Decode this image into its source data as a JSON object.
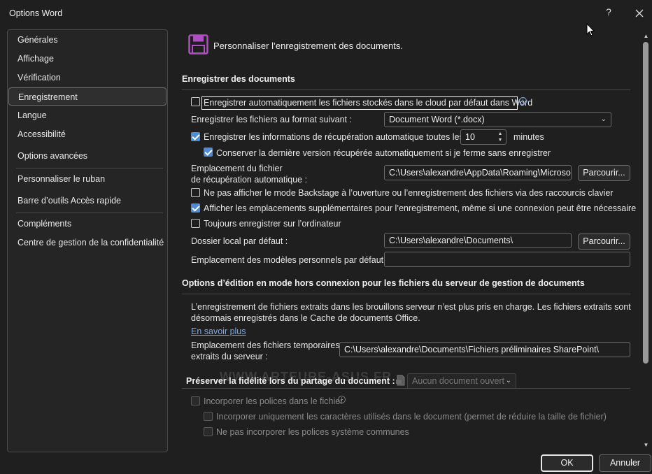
{
  "window": {
    "title": "Options Word",
    "help_label": "?"
  },
  "sidebar": {
    "items": [
      {
        "label": "Générales"
      },
      {
        "label": "Affichage"
      },
      {
        "label": "Vérification"
      },
      {
        "label": "Enregistrement"
      },
      {
        "label": "Langue"
      },
      {
        "label": "Accessibilité"
      },
      {
        "label": "Options avancées"
      },
      {
        "label": "Personnaliser le ruban"
      },
      {
        "label": "Barre d’outils Accès rapide"
      },
      {
        "label": "Compléments"
      },
      {
        "label": "Centre de gestion de la confidentialité"
      }
    ],
    "active_index": 3
  },
  "header": {
    "title": "Personnaliser l’enregistrement des documents."
  },
  "save_section": {
    "title": "Enregistrer des documents",
    "autosave_cloud": {
      "label": "Enregistrer automatiquement les fichiers stockés dans le cloud par défaut dans Word",
      "checked": false
    },
    "format": {
      "label": "Enregistrer les fichiers au format suivant :",
      "value": "Document Word (*.docx)"
    },
    "autorecover": {
      "label": "Enregistrer les informations de récupération automatique toutes les",
      "checked": true,
      "minutes": "10",
      "unit": "minutes"
    },
    "keep_last": {
      "label": "Conserver la dernière version récupérée automatiquement si je ferme sans enregistrer",
      "checked": true
    },
    "autorecover_location": {
      "label_line1": "Emplacement du fichier",
      "label_line2": "de récupération automatique :",
      "value": "C:\\Users\\alexandre\\AppData\\Roaming\\Microsof",
      "browse": "Parcourir..."
    },
    "no_backstage": {
      "label": "Ne pas afficher le mode Backstage à l’ouverture ou l’enregistrement des fichiers via des raccourcis clavier",
      "checked": false
    },
    "show_extra_locations": {
      "label": "Afficher les emplacements supplémentaires pour l’enregistrement, même si une connexion peut être nécessaire",
      "checked": true
    },
    "always_local": {
      "label": "Toujours enregistrer sur l’ordinateur",
      "checked": false
    },
    "local_folder": {
      "label": "Dossier local par défaut :",
      "value": "C:\\Users\\alexandre\\Documents\\",
      "browse": "Parcourir..."
    },
    "templates_location": {
      "label": "Emplacement des modèles personnels par défaut :",
      "value": ""
    }
  },
  "offline_section": {
    "title": "Options d’édition en mode hors connexion pour les fichiers du serveur de gestion de documents",
    "info_line1": "L’enregistrement de fichiers extraits dans les brouillons serveur n’est plus pris en charge. Les fichiers extraits sont",
    "info_line2": "désormais enregistrés dans le Cache de documents Office.",
    "learn_more": "En savoir plus",
    "temp_location": {
      "label_line1": "Emplacement des fichiers temporaires",
      "label_line2": "extraits du serveur :",
      "value": "C:\\Users\\alexandre\\Documents\\Fichiers préliminaires SharePoint\\"
    }
  },
  "fidelity_section": {
    "title": "Préserver la fidélité lors du partage du document :",
    "document_select": "Aucun document ouvert",
    "embed_fonts": {
      "label": "Incorporer les polices dans le fichier",
      "checked": false
    },
    "embed_used_only": {
      "label": "Incorporer uniquement les caractères utilisés dans le document (permet de réduire la taille de fichier)",
      "checked": false
    },
    "no_system_fonts": {
      "label": "Ne pas incorporer les polices système communes",
      "checked": false
    }
  },
  "watermark": "WWW.ARTEURE-ASUS.FR",
  "footer": {
    "ok": "OK",
    "cancel": "Annuler"
  },
  "colors": {
    "accent": "#4c8cd8",
    "link": "#7aa8e6",
    "header_icon": "#b04fc4",
    "background": "#1f1f1f"
  }
}
